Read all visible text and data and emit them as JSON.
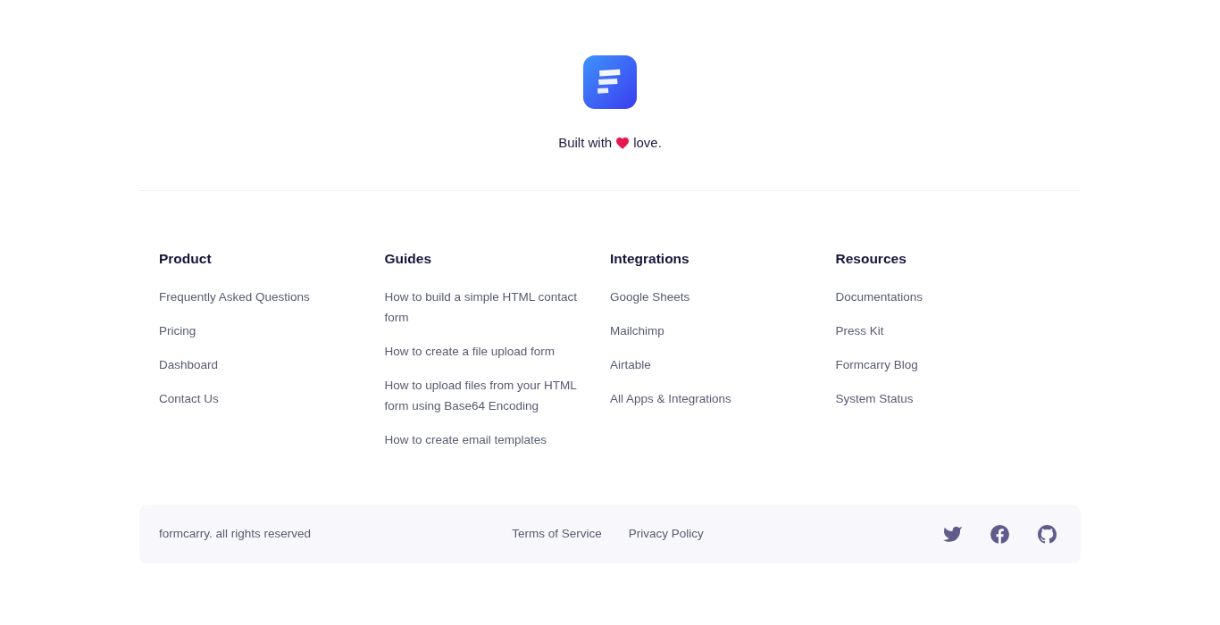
{
  "brand": {
    "tagline_start": "Built with",
    "tagline_end": "love."
  },
  "columns": [
    {
      "heading": "Product",
      "links": [
        "Frequently Asked Questions",
        "Pricing",
        "Dashboard",
        "Contact Us"
      ]
    },
    {
      "heading": "Guides",
      "links": [
        "How to build a simple HTML contact form",
        "How to create a file upload form",
        "How to upload files from your HTML form using Base64 Encoding",
        "How to create email templates"
      ]
    },
    {
      "heading": "Integrations",
      "links": [
        "Google Sheets",
        "Mailchimp",
        "Airtable",
        "All Apps & Integrations"
      ]
    },
    {
      "heading": "Resources",
      "links": [
        "Documentations",
        "Press Kit",
        "Formcarry Blog",
        "System Status"
      ]
    }
  ],
  "bottom_bar": {
    "copyright": "formcarry. all rights reserved",
    "links": [
      "Terms of Service",
      "Privacy Policy"
    ]
  }
}
